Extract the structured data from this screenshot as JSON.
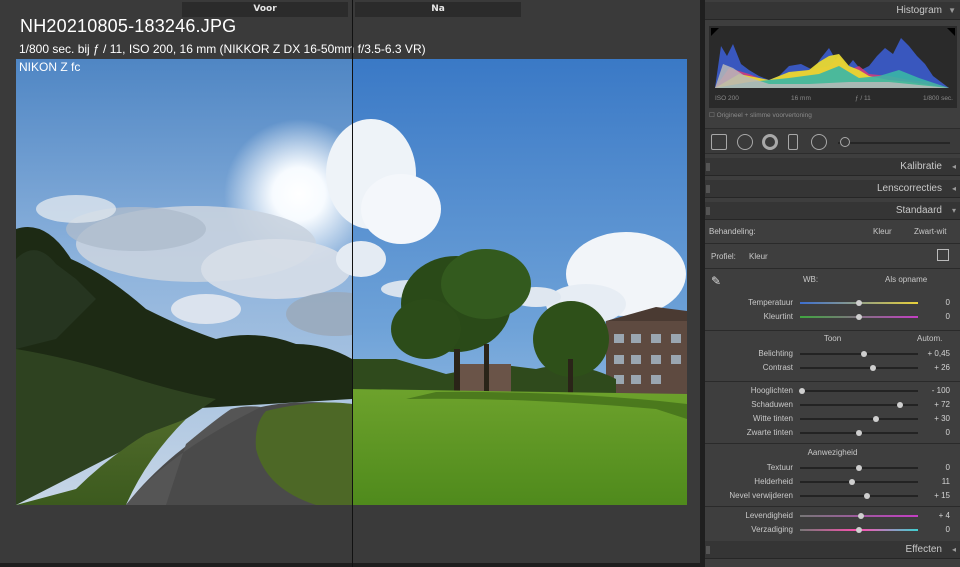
{
  "view": {
    "tab_before": "Voor",
    "tab_after": "Na",
    "file_title": "NH20210805-183246.JPG",
    "exif": "1/800 sec. bij ƒ / 11, ISO 200, 16 mm (NIKKOR Z DX 16-50mm f/3.5-6.3 VR)",
    "camera": "NIKON Z fc"
  },
  "panel": {
    "histogram": {
      "title": "Histogram",
      "info": {
        "iso": "ISO 200",
        "focal": "16 mm",
        "aperture": "ƒ / 11",
        "shutter": "1/800 sec."
      },
      "original_checkbox": "Origineel + slimme voorvertoning"
    },
    "sections": {
      "calibration": "Kalibratie",
      "lens": "Lenscorrecties",
      "standard": "Standaard",
      "effects": "Effecten"
    },
    "treatment": {
      "label": "Behandeling:",
      "color": "Kleur",
      "bw": "Zwart-wit"
    },
    "profile": {
      "label": "Profiel:",
      "value": "Kleur"
    },
    "wb": {
      "label": "WB:",
      "value": "Als opname"
    },
    "tone_header": "Toon",
    "tone_auto": "Autom.",
    "presence_header": "Aanwezigheid",
    "sliders": [
      {
        "label": "Temperatuur",
        "value": "0",
        "pos": 0.5,
        "track": "temp"
      },
      {
        "label": "Kleurtint",
        "value": "0",
        "pos": 0.5,
        "track": "tint"
      },
      {
        "label": "Belichting",
        "value": "+ 0,45",
        "pos": 0.54,
        "track": "gray"
      },
      {
        "label": "Contrast",
        "value": "+ 26",
        "pos": 0.62,
        "track": "gray"
      },
      {
        "label": "Hooglichten",
        "value": "- 100",
        "pos": 0.02,
        "track": "gray"
      },
      {
        "label": "Schaduwen",
        "value": "+ 72",
        "pos": 0.85,
        "track": "gray"
      },
      {
        "label": "Witte tinten",
        "value": "+ 30",
        "pos": 0.64,
        "track": "gray"
      },
      {
        "label": "Zwarte tinten",
        "value": "0",
        "pos": 0.5,
        "track": "gray"
      },
      {
        "label": "Textuur",
        "value": "0",
        "pos": 0.5,
        "track": "gray"
      },
      {
        "label": "Helderheid",
        "value": "11",
        "pos": 0.44,
        "track": "gray"
      },
      {
        "label": "Nevel verwijderen",
        "value": "+ 15",
        "pos": 0.57,
        "track": "gray"
      },
      {
        "label": "Levendigheid",
        "value": "+ 4",
        "pos": 0.52,
        "track": "vib"
      },
      {
        "label": "Verzadiging",
        "value": "0",
        "pos": 0.5,
        "track": "sat"
      }
    ]
  }
}
